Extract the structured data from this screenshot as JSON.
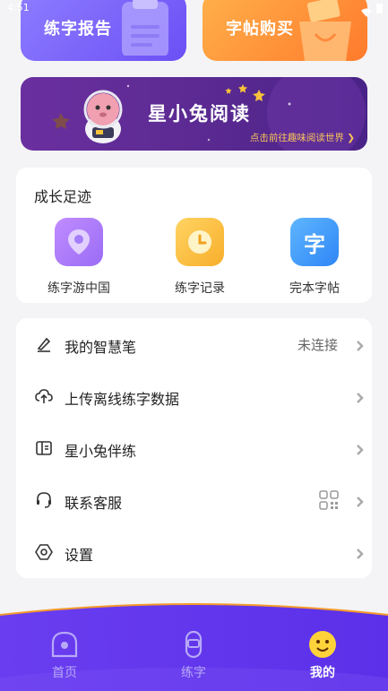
{
  "status": {
    "time": "4:51"
  },
  "top_cards": {
    "report_label": "练字报告",
    "buy_label": "字帖购买"
  },
  "banner": {
    "title": "星小兔阅读",
    "subtitle": "点击前往趣味阅读世界 ❯"
  },
  "growth": {
    "heading": "成长足迹",
    "items": [
      {
        "label": "练字游中国",
        "icon": "map-pin-icon",
        "color": "#a57cf9"
      },
      {
        "label": "练字记录",
        "icon": "clock-icon",
        "color": "#fbbf3f"
      },
      {
        "label": "完本字帖",
        "icon": "character-icon",
        "color": "#3e9bfa",
        "glyph": "字"
      }
    ]
  },
  "settings": {
    "rows": [
      {
        "label": "我的智慧笔",
        "value": "未连接",
        "icon": "pen-icon"
      },
      {
        "label": "上传离线练字数据",
        "icon": "cloud-upload-icon"
      },
      {
        "label": "星小兔伴练",
        "icon": "book-icon"
      },
      {
        "label": "联系客服",
        "icon": "headset-icon"
      },
      {
        "label": "设置",
        "icon": "gear-icon"
      }
    ]
  },
  "bottom_nav": {
    "items": [
      {
        "label": "首页",
        "icon": "home-icon",
        "active": false
      },
      {
        "label": "练字",
        "icon": "practice-icon",
        "active": false
      },
      {
        "label": "我的",
        "icon": "profile-emoji-icon",
        "active": true
      }
    ]
  },
  "colors": {
    "nav_bg": "#6a3df0",
    "banner_bg": "#5d2b93",
    "accent_orange": "#ff7a2c",
    "accent_purple": "#6b4ff5"
  }
}
